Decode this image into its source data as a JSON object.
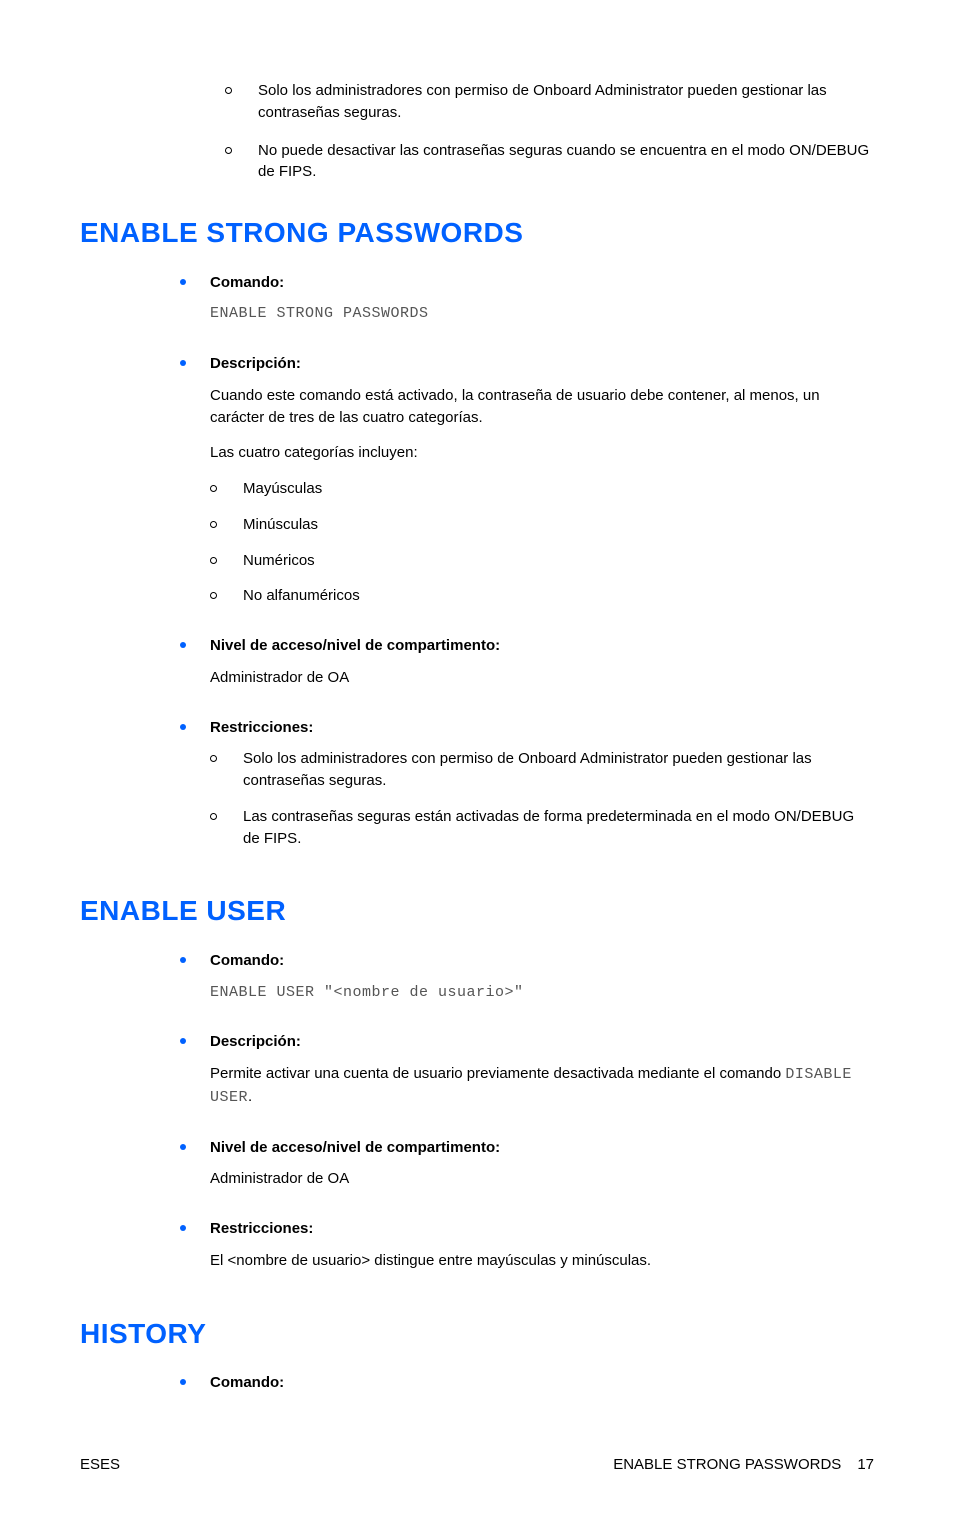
{
  "topRestrictions": [
    "Solo los administradores con permiso de Onboard Administrator pueden gestionar las contraseñas seguras.",
    "No puede desactivar las contraseñas seguras cuando se encuentra en el modo ON/DEBUG de FIPS."
  ],
  "labels": {
    "comando": "Comando:",
    "descripcion": "Descripción:",
    "nivel": "Nivel de acceso/nivel de compartimento:",
    "restricciones": "Restricciones:"
  },
  "sec1": {
    "title": "ENABLE STRONG PASSWORDS",
    "command": "ENABLE STRONG PASSWORDS",
    "desc1": "Cuando este comando está activado, la contraseña de usuario debe contener, al menos, un carácter de tres de las cuatro categorías.",
    "desc2": "Las cuatro categorías incluyen:",
    "categories": [
      "Mayúsculas",
      "Minúsculas",
      "Numéricos",
      "No alfanuméricos"
    ],
    "nivel": "Administrador de OA",
    "restrictions": [
      "Solo los administradores con permiso de Onboard Administrator pueden gestionar las contraseñas seguras.",
      "Las contraseñas seguras están activadas de forma predeterminada en el modo ON/DEBUG de FIPS."
    ]
  },
  "sec2": {
    "title": "ENABLE USER",
    "command": "ENABLE USER \"<nombre de usuario>\"",
    "desc_pre": "Permite activar una cuenta de usuario previamente desactivada mediante el comando ",
    "desc_code": "DISABLE USER",
    "desc_post": ".",
    "nivel": "Administrador de OA",
    "restriction": "El <nombre de usuario> distingue entre mayúsculas y minúsculas."
  },
  "sec3": {
    "title": "HISTORY"
  },
  "footer": {
    "left": "ESES",
    "rightText": "ENABLE STRONG PASSWORDS",
    "pageNum": "17"
  }
}
